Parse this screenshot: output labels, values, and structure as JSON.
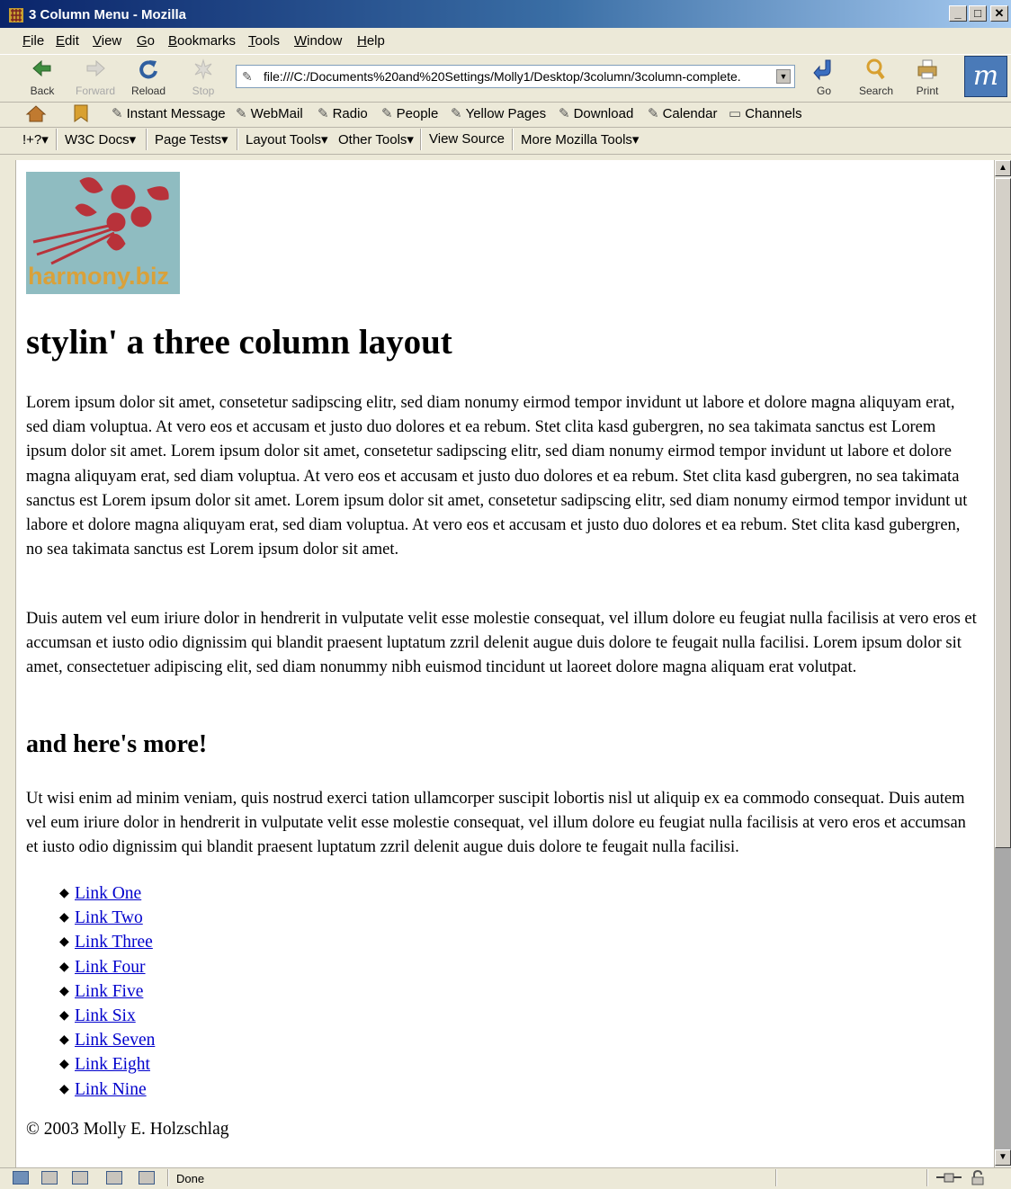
{
  "window": {
    "title": "3 Column Menu - Mozilla"
  },
  "menubar": {
    "items": [
      {
        "u": "F",
        "rest": "ile"
      },
      {
        "u": "E",
        "rest": "dit"
      },
      {
        "u": "V",
        "rest": "iew"
      },
      {
        "u": "G",
        "rest": "o"
      },
      {
        "u": "B",
        "rest": "ookmarks"
      },
      {
        "u": "T",
        "rest": "ools"
      },
      {
        "u": "W",
        "rest": "indow"
      },
      {
        "u": "H",
        "rest": "elp"
      }
    ]
  },
  "navbar": {
    "back": "Back",
    "forward": "Forward",
    "reload": "Reload",
    "stop": "Stop",
    "url": "file:///C:/Documents%20and%20Settings/Molly1/Desktop/3column/3column-complete.",
    "go": "Go",
    "search": "Search",
    "print": "Print"
  },
  "personalbar": {
    "items": [
      "Instant Message",
      "WebMail",
      "Radio",
      "People",
      "Yellow Pages",
      "Download",
      "Calendar",
      "Channels"
    ]
  },
  "devbar": {
    "items": [
      "!+?▾",
      "W3C Docs▾",
      "Page Tests▾",
      "Layout Tools▾",
      "Other Tools▾",
      "View Source",
      "More Mozilla Tools▾"
    ]
  },
  "page": {
    "logo_text": "harmony.biz",
    "heading": "stylin' a three column layout",
    "paragraph1": "Lorem ipsum dolor sit amet, consetetur sadipscing elitr, sed diam nonumy eirmod tempor invidunt ut labore et dolore magna aliquyam erat, sed diam voluptua. At vero eos et accusam et justo duo dolores et ea rebum. Stet clita kasd gubergren, no sea takimata sanctus est Lorem ipsum dolor sit amet. Lorem ipsum dolor sit amet, consetetur sadipscing elitr, sed diam nonumy eirmod tempor invidunt ut labore et dolore magna aliquyam erat, sed diam voluptua. At vero eos et accusam et justo duo dolores et ea rebum. Stet clita kasd gubergren, no sea takimata sanctus est Lorem ipsum dolor sit amet. Lorem ipsum dolor sit amet, consetetur sadipscing elitr, sed diam nonumy eirmod tempor invidunt ut labore et dolore magna aliquyam erat, sed diam voluptua. At vero eos et accusam et justo duo dolores et ea rebum. Stet clita kasd gubergren, no sea takimata sanctus est Lorem ipsum dolor sit amet.",
    "paragraph2": "Duis autem vel eum iriure dolor in hendrerit in vulputate velit esse molestie consequat, vel illum dolore eu feugiat nulla facilisis at vero eros et accumsan et iusto odio dignissim qui blandit praesent luptatum zzril delenit augue duis dolore te feugait nulla facilisi. Lorem ipsum dolor sit amet, consectetuer adipiscing elit, sed diam nonummy nibh euismod tincidunt ut laoreet dolore magna aliquam erat volutpat.",
    "subheading": "and here's more!",
    "paragraph3": "Ut wisi enim ad minim veniam, quis nostrud exerci tation ullamcorper suscipit lobortis nisl ut aliquip ex ea commodo consequat. Duis autem vel eum iriure dolor in hendrerit in vulputate velit esse molestie consequat, vel illum dolore eu feugiat nulla facilisis at vero eros et accumsan et iusto odio dignissim qui blandit praesent luptatum zzril delenit augue duis dolore te feugait nulla facilisi.",
    "links": [
      "Link One",
      "Link Two",
      "Link Three",
      "Link Four",
      "Link Five",
      "Link Six",
      "Link Seven",
      "Link Eight",
      "Link Nine"
    ],
    "footer": "© 2003 Molly E. Holzschlag"
  },
  "statusbar": {
    "text": "Done"
  },
  "colors": {
    "link": "#0000cc",
    "logo_bg": "#8fbcc1",
    "logo_flower": "#b8323a",
    "logo_text": "#d9a13a"
  }
}
